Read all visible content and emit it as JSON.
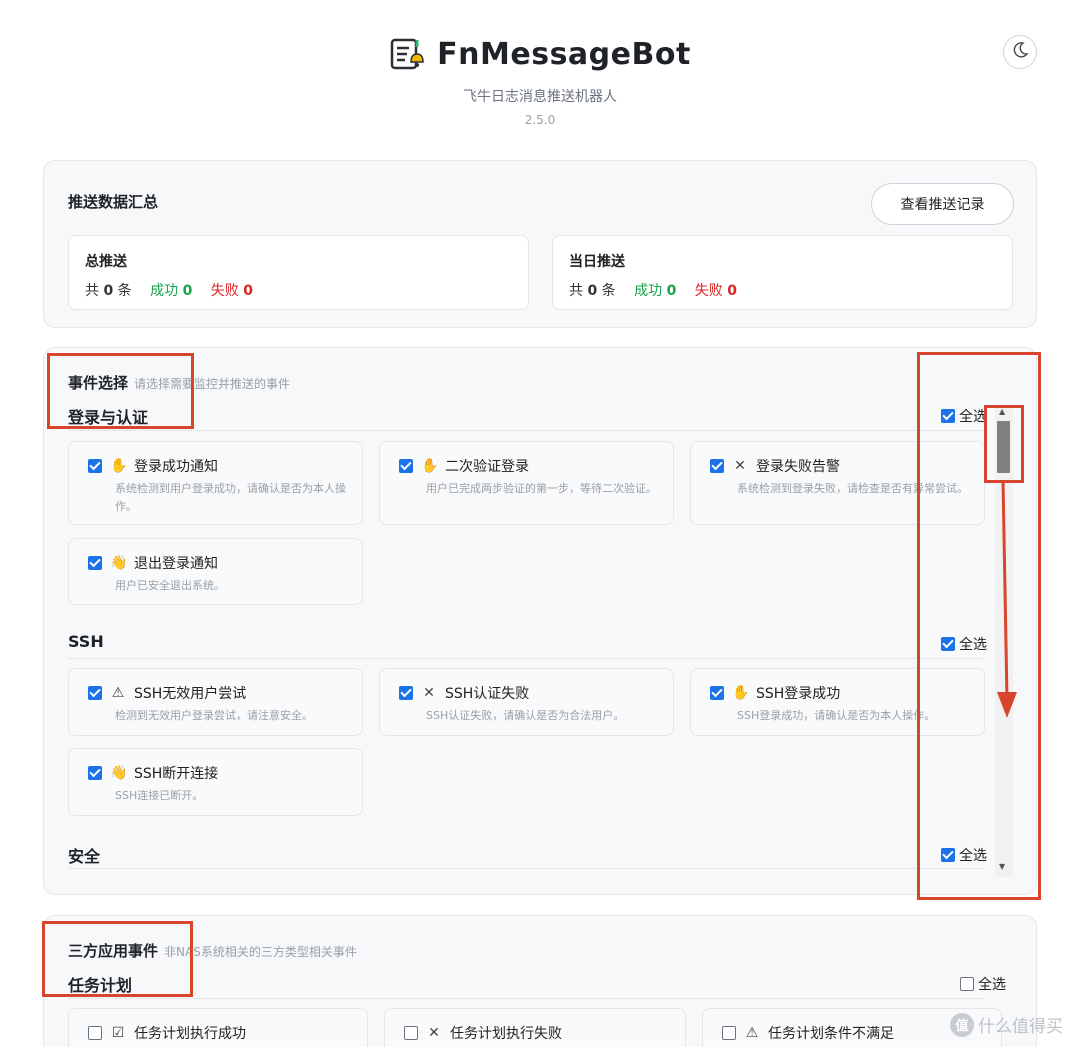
{
  "app": {
    "title": "FnMessageBot",
    "subtitle": "飞牛日志消息推送机器人",
    "version": "2.5.0",
    "icon": "notebook-bell-icon",
    "theme_icon": "moon-icon"
  },
  "summary": {
    "title": "推送数据汇总",
    "records_button": "查看推送记录",
    "total": {
      "label": "总推送",
      "prefix": "共",
      "count": "0",
      "unit": "条",
      "success_label": "成功",
      "success": "0",
      "fail_label": "失败",
      "fail": "0"
    },
    "today": {
      "label": "当日推送",
      "prefix": "共",
      "count": "0",
      "unit": "条",
      "success_label": "成功",
      "success": "0",
      "fail_label": "失败",
      "fail": "0"
    }
  },
  "events": {
    "title": "事件选择",
    "hint": "请选择需要监控并推送的事件",
    "select_all_label": "全选",
    "groups": [
      {
        "title": "登录与认证",
        "all_checked": true,
        "items": [
          {
            "icon": "hand-icon",
            "label": "登录成功通知",
            "desc": "系统检测到用户登录成功，请确认是否为本人操作。",
            "checked": true
          },
          {
            "icon": "hand-icon",
            "label": "二次验证登录",
            "desc": "用户已完成两步验证的第一步，等待二次验证。",
            "checked": true
          },
          {
            "icon": "x-icon",
            "label": "登录失败告警",
            "desc": "系统检测到登录失败，请检查是否有异常尝试。",
            "checked": true
          },
          {
            "icon": "wave-icon",
            "label": "退出登录通知",
            "desc": "用户已安全退出系统。",
            "checked": true
          }
        ]
      },
      {
        "title": "SSH",
        "all_checked": true,
        "items": [
          {
            "icon": "warning-icon",
            "label": "SSH无效用户尝试",
            "desc": "检测到无效用户登录尝试，请注意安全。",
            "checked": true
          },
          {
            "icon": "x-icon",
            "label": "SSH认证失败",
            "desc": "SSH认证失败，请确认是否为合法用户。",
            "checked": true
          },
          {
            "icon": "hand-icon",
            "label": "SSH登录成功",
            "desc": "SSH登录成功，请确认是否为本人操作。",
            "checked": true
          },
          {
            "icon": "wave-icon",
            "label": "SSH断开连接",
            "desc": "SSH连接已断开。",
            "checked": true
          }
        ]
      },
      {
        "title": "安全",
        "all_checked": true,
        "items": []
      }
    ]
  },
  "third_party": {
    "title": "三方应用事件",
    "hint": "非NAS系统相关的三方类型相关事件",
    "select_all_label": "全选",
    "group_title": "任务计划",
    "all_checked": false,
    "items": [
      {
        "icon": "check-box-icon",
        "label": "任务计划执行成功",
        "checked": false
      },
      {
        "icon": "x-icon",
        "label": "任务计划执行失败",
        "checked": false
      },
      {
        "icon": "warning-icon",
        "label": "任务计划条件不满足",
        "checked": false
      }
    ]
  },
  "watermark": {
    "text": "什么值得买",
    "badge": "值"
  },
  "colors": {
    "accent": "#1a73e8",
    "success": "#16a34a",
    "fail": "#dc2626",
    "annotation": "#d9442d"
  }
}
